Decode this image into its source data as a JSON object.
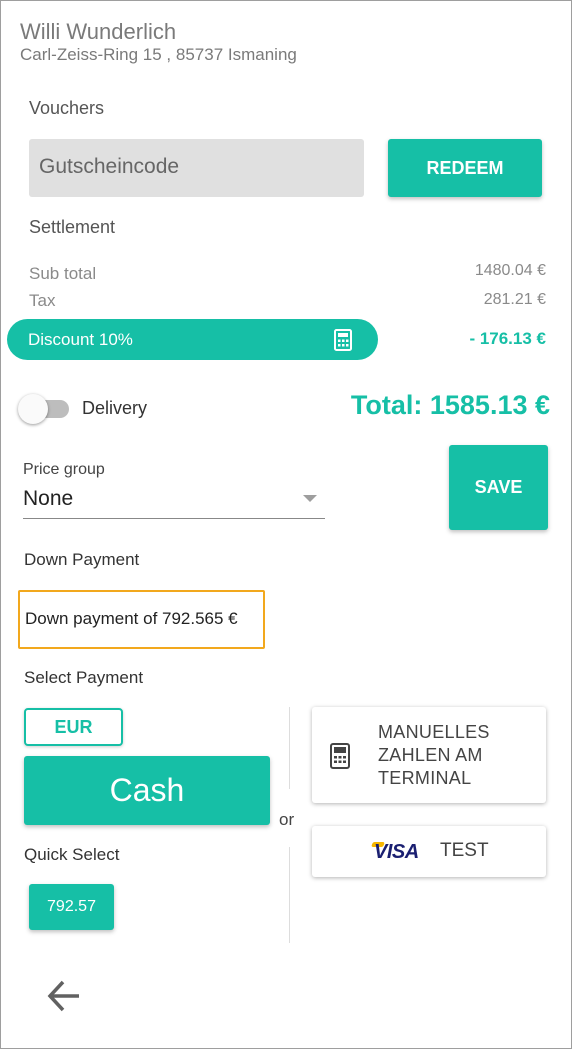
{
  "customer": {
    "name": "Willi Wunderlich",
    "address": "Carl-Zeiss-Ring 15 , 85737 Ismaning"
  },
  "vouchers": {
    "heading": "Vouchers",
    "placeholder": "Gutscheincode",
    "redeem_label": "REDEEM"
  },
  "settlement": {
    "heading": "Settlement",
    "subtotal_label": "Sub total",
    "subtotal_value": "1480.04 €",
    "tax_label": "Tax",
    "tax_value": "281.21 €",
    "discount_label": "Discount 10%",
    "discount_value": "- 176.13 €",
    "discount_icon": "calculator-icon"
  },
  "delivery": {
    "label": "Delivery",
    "enabled": false
  },
  "total": "Total: 1585.13 €",
  "price_group": {
    "label": "Price group",
    "value": "None"
  },
  "save_label": "SAVE",
  "down_payment": {
    "heading": "Down Payment",
    "text": "Down payment of 792.565 €"
  },
  "payment": {
    "heading": "Select Payment",
    "currency": "EUR",
    "cash_label": "Cash",
    "or_label": "or",
    "quick_select_label": "Quick Select",
    "quick_values": [
      "792.57"
    ],
    "terminal_label": "MANUELLES ZAHLEN AM TERMINAL",
    "terminal_icon": "card-terminal-icon",
    "visa_logo": "VISA",
    "visa_label": "TEST"
  },
  "colors": {
    "accent": "#16bfa6",
    "highlight_border": "#f2a81d"
  },
  "back_icon": "arrow-left-icon"
}
